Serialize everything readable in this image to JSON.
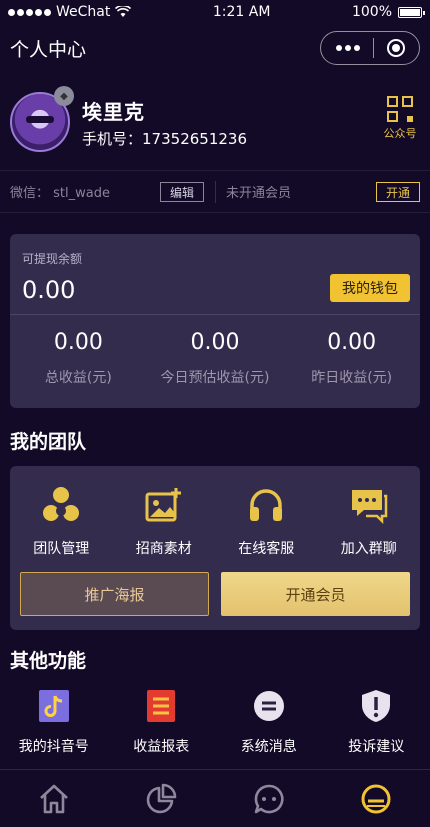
{
  "status_bar": {
    "carrier": "WeChat",
    "time": "1:21 AM",
    "battery": "100%"
  },
  "nav": {
    "title": "个人中心"
  },
  "profile": {
    "name": "埃里克",
    "phone_label": "手机号：",
    "phone": "17352651236",
    "qr_label": "公众号"
  },
  "info": {
    "wechat_label": "微信：",
    "wechat_id": "stl_wade",
    "edit_label": "编辑",
    "member_status": "未开通会员",
    "open_label": "开通"
  },
  "balance": {
    "label": "可提现余额",
    "amount": "0.00",
    "wallet_label": "我的钱包",
    "stats": [
      {
        "value": "0.00",
        "label": "总收益(元)"
      },
      {
        "value": "0.00",
        "label": "今日预估收益(元)"
      },
      {
        "value": "0.00",
        "label": "昨日收益(元)"
      }
    ]
  },
  "team": {
    "title": "我的团队",
    "items": [
      {
        "label": "团队管理",
        "icon": "team-icon"
      },
      {
        "label": "招商素材",
        "icon": "image-add-icon"
      },
      {
        "label": "在线客服",
        "icon": "headset-icon"
      },
      {
        "label": "加入群聊",
        "icon": "chat-icon"
      }
    ],
    "poster_label": "推广海报",
    "member_label": "开通会员"
  },
  "other": {
    "title": "其他功能",
    "items": [
      {
        "label": "我的抖音号",
        "icon": "tiktok-icon"
      },
      {
        "label": "收益报表",
        "icon": "report-icon"
      },
      {
        "label": "系统消息",
        "icon": "message-icon"
      },
      {
        "label": "投诉建议",
        "icon": "shield-alert-icon"
      }
    ]
  },
  "tabs": [
    {
      "icon": "home-icon",
      "active": false
    },
    {
      "icon": "pie-chart-icon",
      "active": false
    },
    {
      "icon": "chat-bubble-icon",
      "active": false
    },
    {
      "icon": "profile-icon",
      "active": true
    }
  ],
  "colors": {
    "background": "#120a26",
    "card": "#342c4d",
    "gold": "#e8c34a",
    "wallet_button": "#f1c232"
  }
}
